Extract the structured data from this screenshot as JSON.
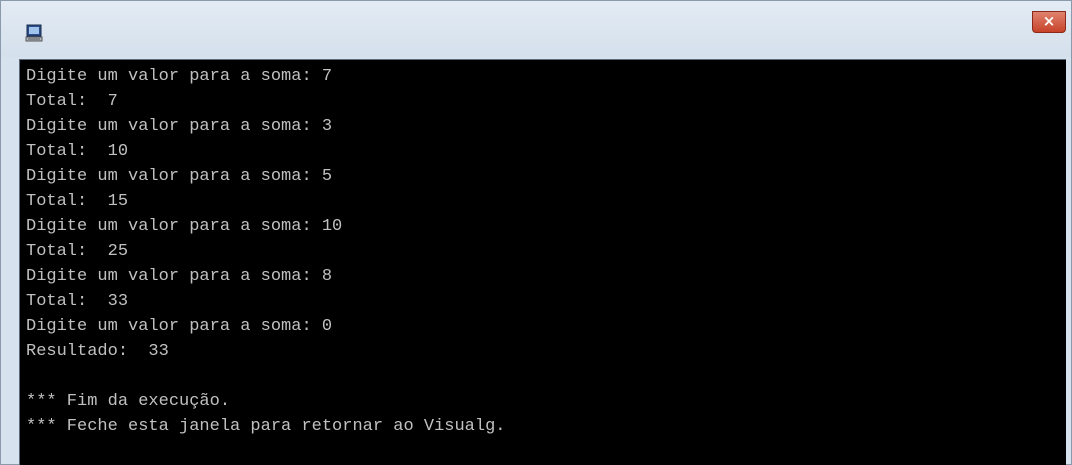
{
  "window": {
    "close_glyph": "×",
    "icon": "console-app-icon"
  },
  "console": {
    "lines": [
      "Digite um valor para a soma: 7",
      "Total:  7",
      "Digite um valor para a soma: 3",
      "Total:  10",
      "Digite um valor para a soma: 5",
      "Total:  15",
      "Digite um valor para a soma: 10",
      "Total:  25",
      "Digite um valor para a soma: 8",
      "Total:  33",
      "Digite um valor para a soma: 0",
      "Resultado:  33",
      "",
      "*** Fim da execução.",
      "*** Feche esta janela para retornar ao Visualg."
    ]
  },
  "colors": {
    "console_background": "#000000",
    "console_text": "#c0c0c0",
    "close_button": "#c7432a"
  }
}
